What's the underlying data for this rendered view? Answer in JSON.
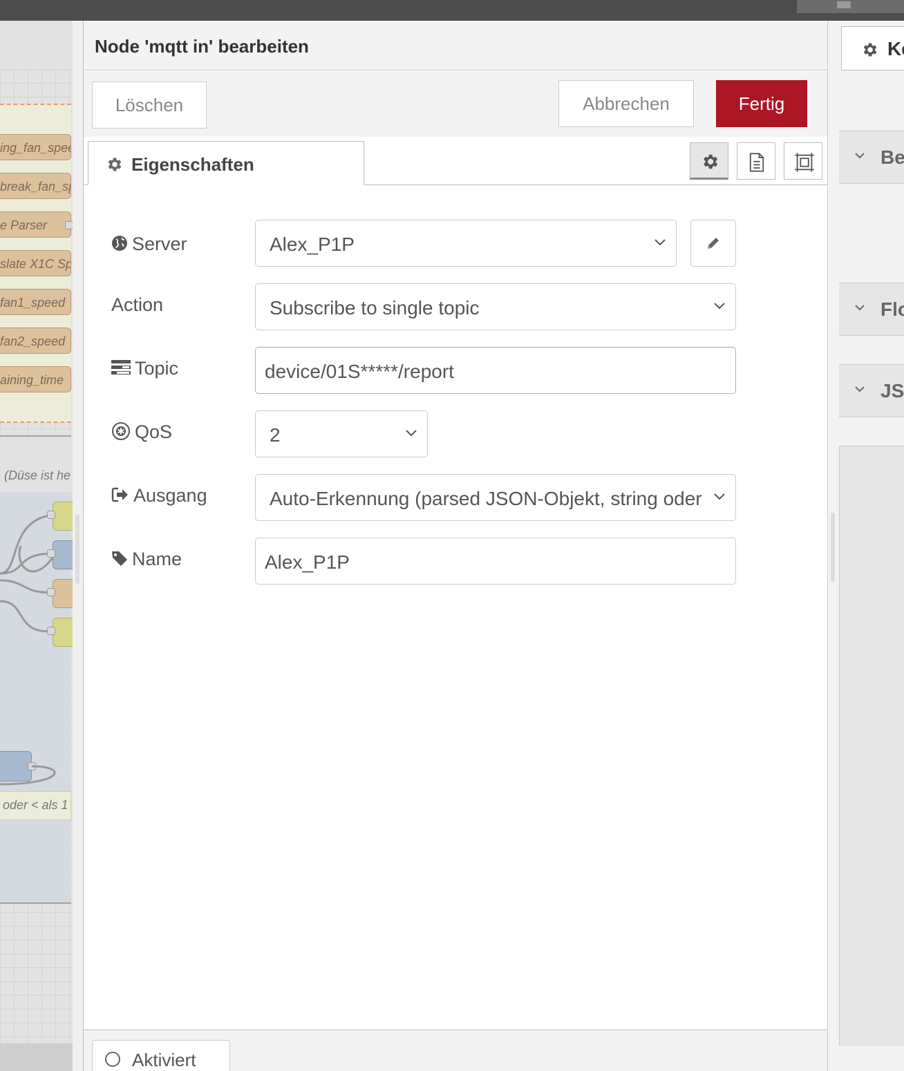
{
  "dialog": {
    "title": "Node 'mqtt in' bearbeiten",
    "delete_label": "Löschen",
    "cancel_label": "Abbrechen",
    "done_label": "Fertig",
    "tab_properties_label": "Eigenschaften",
    "footer_toggle_label": "Aktiviert"
  },
  "form": {
    "server": {
      "label": "Server",
      "value": "Alex_P1P"
    },
    "action": {
      "label": "Action",
      "value": "Subscribe to single topic"
    },
    "topic": {
      "label": "Topic",
      "value": "device/01S*****/report"
    },
    "qos": {
      "label": "QoS",
      "value": "2"
    },
    "output": {
      "label": "Ausgang",
      "value": "Auto-Erkennung (parsed JSON-Objekt, string oder"
    },
    "name": {
      "label": "Name",
      "value": "Alex_P1P"
    }
  },
  "canvas": {
    "nodes": [
      "ing_fan_spee",
      "break_fan_sp",
      "e Parser",
      "slate X1C Sp",
      "fan1_speed",
      "fan2_speed",
      "aining_time"
    ],
    "group_label": "(Düse ist he",
    "comment_label": "oder < als 1"
  },
  "sidebar": {
    "tab_label": "Ke",
    "sections": [
      "Be",
      "Flo",
      "JS"
    ]
  },
  "colors": {
    "primary_button": "#ad1625",
    "focus_border": "#85b7e4",
    "function_node": "#dcc19c",
    "json_node": "#d7d78a"
  }
}
